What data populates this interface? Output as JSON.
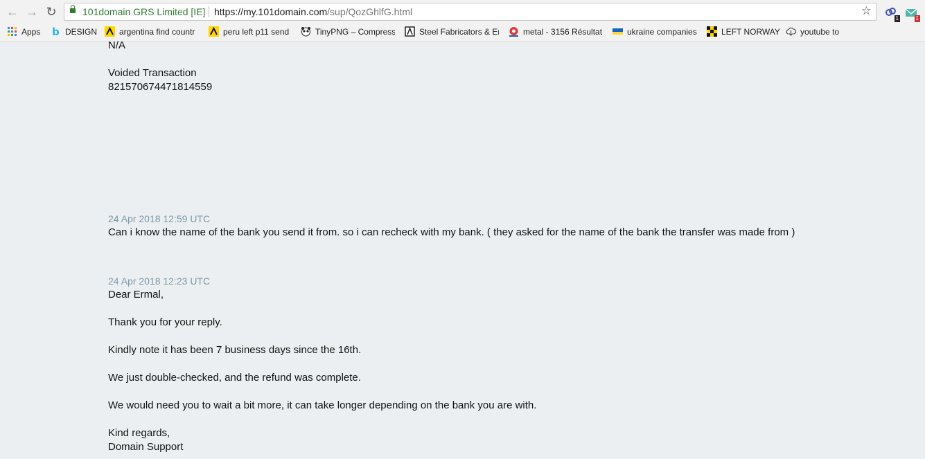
{
  "browser": {
    "site_identity": "101domain GRS Limited [IE]",
    "url_host": "https://my.101domain.com",
    "url_path": "/sup/QozGhlfG.html",
    "extension_badges": [
      "1",
      "1"
    ]
  },
  "bookmarks": [
    {
      "label": "Apps",
      "icon": "apps-grid-icon"
    },
    {
      "label": "DESIGN",
      "icon": "b-logo-icon"
    },
    {
      "label": "argentina find countr",
      "icon": "yellow-pages-icon"
    },
    {
      "label": "peru left p11 send",
      "icon": "yellow-pages-icon"
    },
    {
      "label": "TinyPNG – Compress",
      "icon": "panda-icon"
    },
    {
      "label": "Steel Fabricators & Er",
      "icon": "directory-icon"
    },
    {
      "label": "metal - 3156 Résultat",
      "icon": "red-circle-icon"
    },
    {
      "label": "ukraine companies",
      "icon": "ua-logo-icon"
    },
    {
      "label": "LEFT NORWAY",
      "icon": "checker-icon"
    },
    {
      "label": "youtube to",
      "icon": "cloud-download-icon"
    }
  ],
  "thread": {
    "top_fragment": "N/A",
    "voided_label": "Voided Transaction",
    "voided_number": "821570674471814559",
    "messages": [
      {
        "timestamp": "24 Apr 2018 12:59 UTC",
        "lines": [
          "Can i know the name of the bank you send it from. so i can recheck with my bank. ( they asked for the name of the bank the transfer was made from )"
        ]
      },
      {
        "timestamp": "24 Apr 2018 12:23 UTC",
        "lines": [
          "Dear Ermal,",
          "Thank you for your reply.",
          "Kindly note it has been 7 business days since the 16th.",
          "We just double-checked, and the refund was complete.",
          "We would need you to wait a bit more, it can take longer depending on the bank you are with.",
          "Kind regards,",
          "Domain Support"
        ]
      }
    ]
  }
}
